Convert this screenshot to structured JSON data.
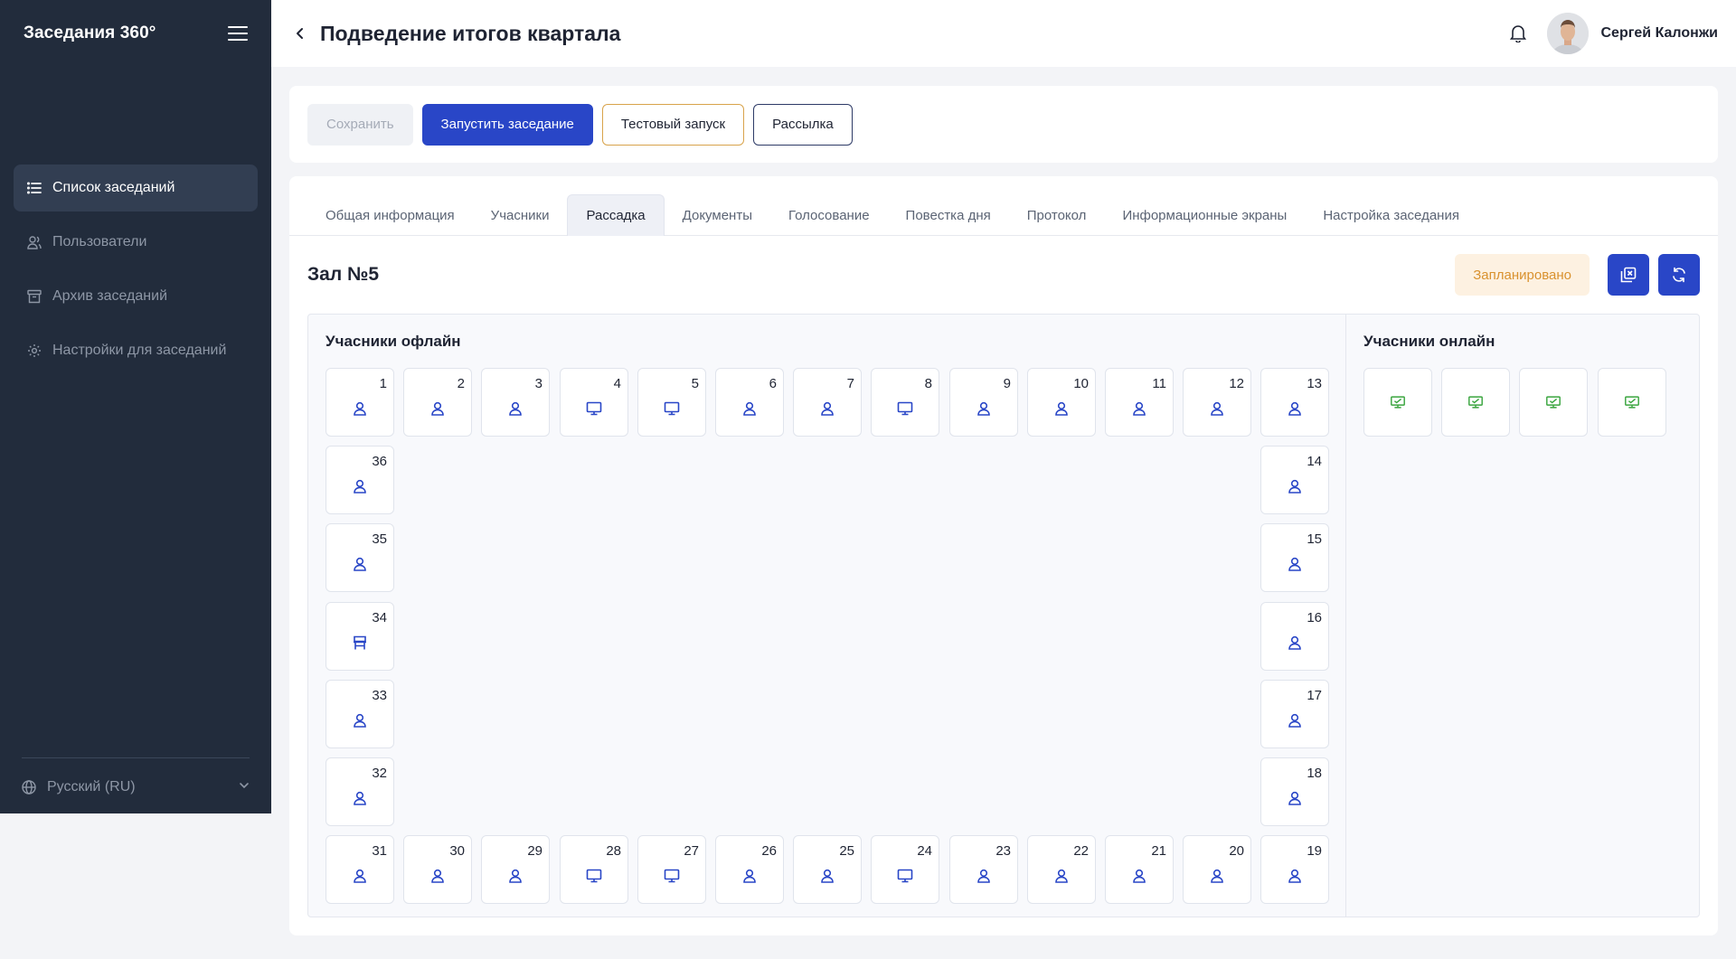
{
  "app": {
    "brand": "Заседания 360°",
    "page_title": "Подведение итогов квартала",
    "user_name": "Сергей Калонжи"
  },
  "sidebar": {
    "items": [
      {
        "label": "Список заседаний",
        "icon": "list-icon",
        "active": true
      },
      {
        "label": "Пользователи",
        "icon": "users-icon",
        "active": false
      },
      {
        "label": "Архив заседаний",
        "icon": "archive-icon",
        "active": false
      },
      {
        "label": "Настройки для заседаний",
        "icon": "gear-icon",
        "active": false
      }
    ],
    "language": "Русский (RU)"
  },
  "actions": {
    "save": "Сохранить",
    "start": "Запустить заседание",
    "test_run": "Тестовый запуск",
    "mailing": "Рассылка"
  },
  "tabs": [
    {
      "label": "Общая информация",
      "active": false
    },
    {
      "label": "Учасники",
      "active": false
    },
    {
      "label": "Рассадка",
      "active": true
    },
    {
      "label": "Документы",
      "active": false
    },
    {
      "label": "Голосование",
      "active": false
    },
    {
      "label": "Повестка дня",
      "active": false
    },
    {
      "label": "Протокол",
      "active": false
    },
    {
      "label": "Информационные экраны",
      "active": false
    },
    {
      "label": "Настройка заседания",
      "active": false
    }
  ],
  "hall": {
    "title": "Зал №5",
    "status": "Запланировано"
  },
  "offline": {
    "title": "Учасники офлайн",
    "seats": [
      {
        "num": "1",
        "type": "person"
      },
      {
        "num": "2",
        "type": "person"
      },
      {
        "num": "3",
        "type": "person"
      },
      {
        "num": "4",
        "type": "monitor"
      },
      {
        "num": "5",
        "type": "monitor"
      },
      {
        "num": "6",
        "type": "person"
      },
      {
        "num": "7",
        "type": "person"
      },
      {
        "num": "8",
        "type": "monitor"
      },
      {
        "num": "9",
        "type": "person"
      },
      {
        "num": "10",
        "type": "person"
      },
      {
        "num": "11",
        "type": "person"
      },
      {
        "num": "12",
        "type": "person"
      },
      {
        "num": "13",
        "type": "person"
      },
      {
        "num": "14",
        "type": "person"
      },
      {
        "num": "15",
        "type": "person"
      },
      {
        "num": "16",
        "type": "person"
      },
      {
        "num": "17",
        "type": "person"
      },
      {
        "num": "18",
        "type": "person"
      },
      {
        "num": "19",
        "type": "person"
      },
      {
        "num": "20",
        "type": "person"
      },
      {
        "num": "21",
        "type": "person"
      },
      {
        "num": "22",
        "type": "person"
      },
      {
        "num": "23",
        "type": "person"
      },
      {
        "num": "24",
        "type": "monitor"
      },
      {
        "num": "25",
        "type": "person"
      },
      {
        "num": "26",
        "type": "person"
      },
      {
        "num": "27",
        "type": "monitor"
      },
      {
        "num": "28",
        "type": "monitor"
      },
      {
        "num": "29",
        "type": "person"
      },
      {
        "num": "30",
        "type": "person"
      },
      {
        "num": "31",
        "type": "person"
      },
      {
        "num": "32",
        "type": "person"
      },
      {
        "num": "33",
        "type": "person"
      },
      {
        "num": "34",
        "type": "chair"
      },
      {
        "num": "35",
        "type": "person"
      },
      {
        "num": "36",
        "type": "person"
      }
    ]
  },
  "online": {
    "title": "Учасники онлайн",
    "seats": [
      {
        "type": "online-monitor"
      },
      {
        "type": "online-monitor"
      },
      {
        "type": "online-monitor"
      },
      {
        "type": "online-monitor"
      }
    ]
  },
  "colors": {
    "accent": "#2946c7",
    "sidebar": "#222c3c",
    "status_text": "#d9912e",
    "status_bg": "#fdf1e1",
    "online_icon": "#3aa53f"
  }
}
